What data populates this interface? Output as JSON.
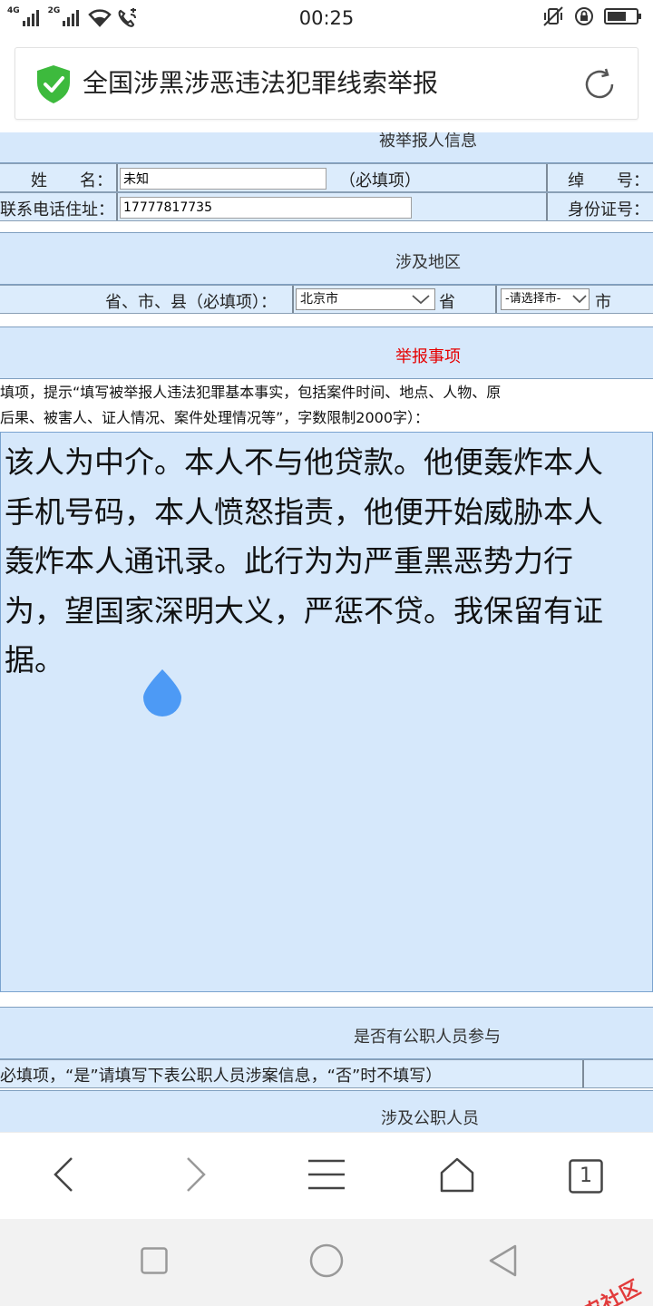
{
  "status_bar": {
    "network_1": "4G",
    "network_2": "2G",
    "time": "00:25"
  },
  "browser": {
    "page_title": "全国涉黑涉恶违法犯罪线索举报",
    "shield_color": "#3dba3d",
    "tab_count": "1",
    "icons": [
      "shield-check-icon",
      "reload-icon",
      "back-icon",
      "forward-icon",
      "menu-icon",
      "home-icon",
      "tabs-icon"
    ]
  },
  "form": {
    "reported_person": {
      "heading": "被举报人信息",
      "name_label": "姓　　名：",
      "name_value": "未知",
      "required_note": "（必填项）",
      "nickname_label": "绰　　号：",
      "phone_label": "联系电话住址：",
      "phone_value": "17777817735",
      "id_label": "身份证号："
    },
    "region": {
      "heading": "涉及地区",
      "label": "省、市、县（必填项）：",
      "province_value": "北京市",
      "province_suffix": "省",
      "city_value": "-请选择市-",
      "city_suffix": "市"
    },
    "matter": {
      "heading": "举报事项",
      "hint_line1": "填项，提示“填写被举报人违法犯罪基本事实，包括案件时间、地点、人物、原",
      "hint_line2": "后果、被害人、证人情况、案件处理情况等”，字数限制2000字）：",
      "content": "该人为中介。本人不与他贷款。他便轰炸本人手机号码，本人愤怒指责，他便开始威胁本人轰炸本人通讯录。此行为为严重黑恶势力行为，望国家深明大义，严惩不贷。我保留有证据。"
    },
    "official_involvement": {
      "heading": "是否有公职人员参与",
      "hint": "必填项，“是”请填写下表公职人员涉案信息，“否”时不填写）"
    },
    "officials": {
      "heading": "涉及公职人员"
    }
  },
  "colors": {
    "panel_bg": "#d6e8fb",
    "required_red": "#e60000",
    "handle_blue": "#4d9af5"
  },
  "watermark": "卡农社区"
}
